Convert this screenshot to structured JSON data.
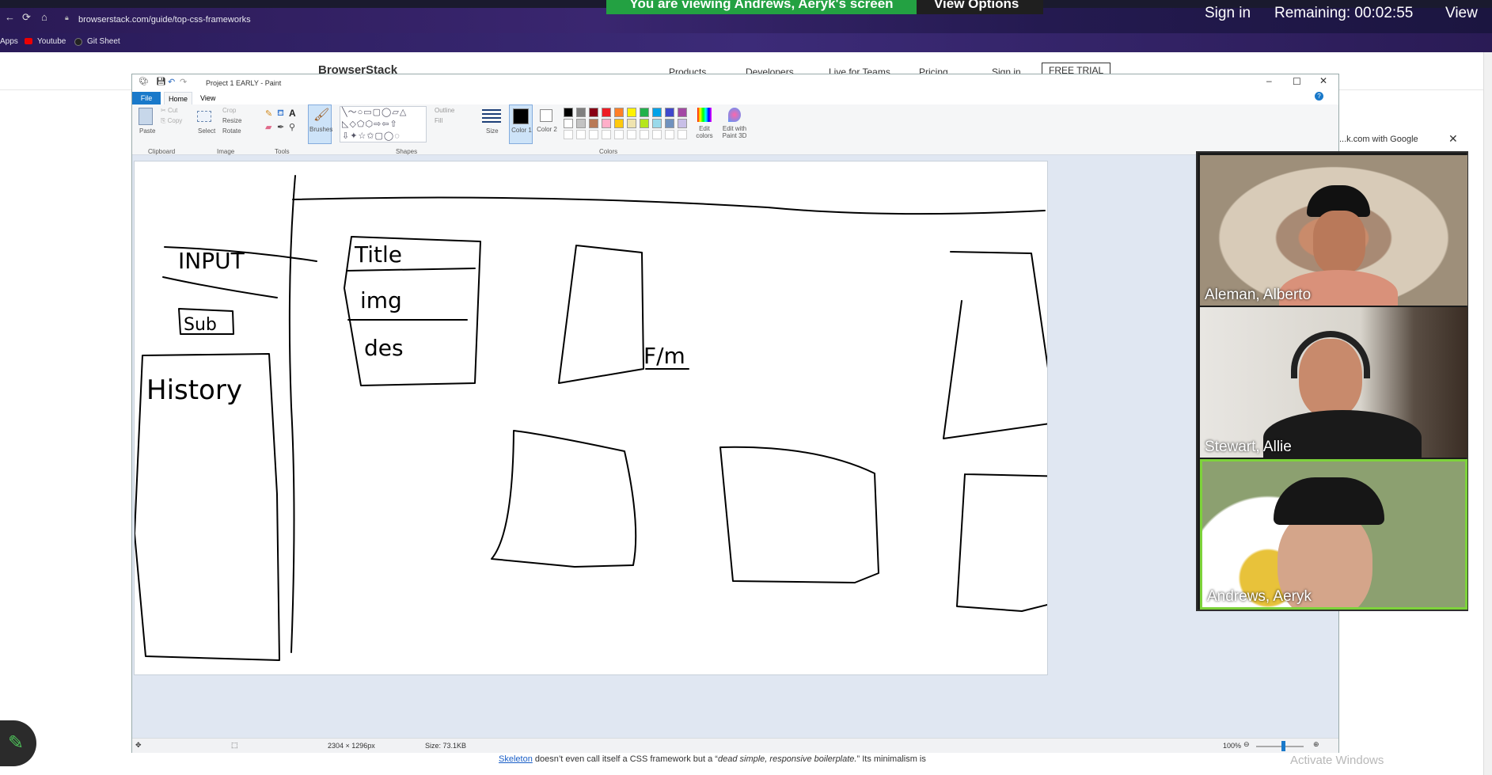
{
  "browser": {
    "url": "browserstack.com/guide/top-css-frameworks",
    "bookmarks": [
      "Apps",
      "Youtube",
      "Git Sheet"
    ],
    "brand": "BrowserStack",
    "nav": [
      "Products",
      "Developers",
      "Live for Teams",
      "Pricing",
      "Sign in",
      "FREE TRIAL"
    ],
    "google_prompt": "...k.com with Google"
  },
  "zoom": {
    "banner": "You are viewing Andrews, Aeryk's screen",
    "view_options": "View Options",
    "sign_in": "Sign in",
    "remaining": "Remaining: 00:02:55",
    "view": "View",
    "participants": [
      "Aleman, Alberto",
      "Stewart, Allie",
      "Andrews, Aeryk"
    ],
    "active_speaker_color": "#7dd33a"
  },
  "paint": {
    "title": "Project 1 EARLY - Paint",
    "tabs": [
      "File",
      "Home",
      "View"
    ],
    "clipboard": {
      "paste": "Paste",
      "cut": "Cut",
      "copy": "Copy",
      "label": "Clipboard"
    },
    "image": {
      "select": "Select",
      "crop": "Crop",
      "resize": "Resize",
      "rotate": "Rotate",
      "label": "Image"
    },
    "tools": {
      "label": "Tools",
      "brushes": "Brushes"
    },
    "shapes": {
      "label": "Shapes",
      "outline": "Outline",
      "fill": "Fill"
    },
    "size": "Size",
    "color1": "Color 1",
    "color2": "Color 2",
    "colors_label": "Colors",
    "edit_colors": "Edit colors",
    "edit_3d": "Edit with Paint 3D",
    "palette": [
      "#000000",
      "#7f7f7f",
      "#880015",
      "#ed1c24",
      "#ff7f27",
      "#fff200",
      "#22b14c",
      "#00a2e8",
      "#3f48cc",
      "#a349a4",
      "#ffffff",
      "#c3c3c3",
      "#b97a57",
      "#ffaec9",
      "#ffc90e",
      "#efe4b0",
      "#b5e61d",
      "#99d9ea",
      "#7092be",
      "#c8bfe7"
    ],
    "status": {
      "dimensions": "2304 × 1296px",
      "size": "Size: 73.1KB",
      "zoom": "100%"
    },
    "sketch_labels": [
      "INPUT",
      "Sub",
      "History",
      "Title",
      "img",
      "des",
      "F/m"
    ]
  },
  "page": {
    "link": "Skeleton",
    "text": " doesn’t even call itself a CSS framework but a “",
    "quote": "dead simple, responsive boilerplate.",
    "text2": "” Its minimalism is",
    "activate": "Activate Windows"
  }
}
